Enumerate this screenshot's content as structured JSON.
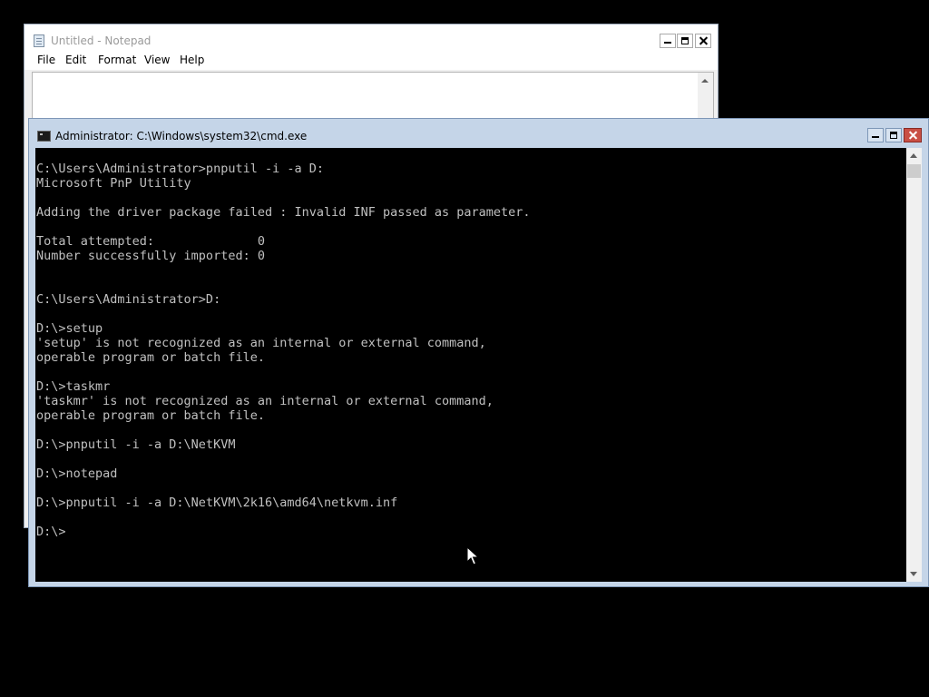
{
  "notepad": {
    "title": "Untitled - Notepad",
    "menu": [
      "File",
      "Edit",
      "Format",
      "View",
      "Help"
    ],
    "content": ""
  },
  "cmd": {
    "title": "Administrator: C:\\Windows\\system32\\cmd.exe",
    "output": "C:\\Users\\Administrator>pnputil -i -a D:\nMicrosoft PnP Utility\n\nAdding the driver package failed : Invalid INF passed as parameter.\n\nTotal attempted:              0\nNumber successfully imported: 0\n\n\nC:\\Users\\Administrator>D:\n\nD:\\>setup\n'setup' is not recognized as an internal or external command,\noperable program or batch file.\n\nD:\\>taskmr\n'taskmr' is not recognized as an internal or external command,\noperable program or batch file.\n\nD:\\>pnputil -i -a D:\\NetKVM\n\nD:\\>notepad\n\nD:\\>pnputil -i -a D:\\NetKVM\\2k16\\amd64\\netkvm.inf\n\nD:\\>"
  },
  "icons": {
    "notepad": "notepad-app-icon",
    "cmd": "cmd-app-icon",
    "minimize": "minimize-icon",
    "maximize": "maximize-icon",
    "close": "close-icon",
    "cursor": "mouse-pointer-icon"
  },
  "colors": {
    "console_bg": "#000000",
    "console_text": "#c0c0c0",
    "cmd_frame": "#c5d5e8",
    "close_button": "#c94f44"
  }
}
